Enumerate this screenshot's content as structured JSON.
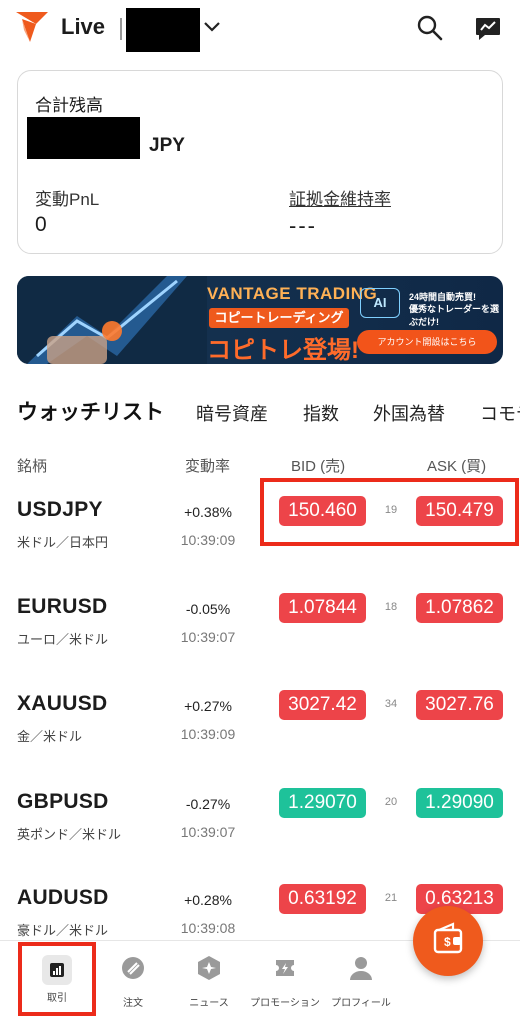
{
  "header": {
    "mode_label": "Live",
    "icons": [
      "search-icon",
      "chart-message-icon",
      "chevron-down-icon"
    ],
    "brand_color": "#ef5a1d"
  },
  "balance_card": {
    "total_label": "合計残高",
    "currency": "JPY",
    "pnl_label": "変動PnL",
    "pnl_value": "0",
    "margin_label": "証拠金維持率",
    "margin_value": "---"
  },
  "banner": {
    "title": "VANTAGE TRADING",
    "subtitle": "コピートレーディング",
    "headline": "コピトレ登場!",
    "ai_badge": "AI",
    "ai_text_1": "24時間自動売買!",
    "ai_text_2": "優秀なトレーダーを選ぶだけ!",
    "cta": "アカウント開設はこちら"
  },
  "tabs": [
    {
      "label": "ウォッチリスト"
    },
    {
      "label": "暗号資産"
    },
    {
      "label": "指数"
    },
    {
      "label": "外国為替"
    },
    {
      "label": "コモデ"
    }
  ],
  "columns": {
    "symbol": "銘柄",
    "change": "変動率",
    "bid": "BID (売)",
    "ask": "ASK (買)"
  },
  "rows": [
    {
      "symbol": "USDJPY",
      "desc": "米ドル／日本円",
      "change": "+0.38%",
      "time": "10:39:09",
      "bid": "150.460",
      "spread": "19",
      "ask": "150.479",
      "color": "red"
    },
    {
      "symbol": "EURUSD",
      "desc": "ユーロ／米ドル",
      "change": "-0.05%",
      "time": "10:39:07",
      "bid": "1.07844",
      "spread": "18",
      "ask": "1.07862",
      "color": "red"
    },
    {
      "symbol": "XAUUSD",
      "desc": "金／米ドル",
      "change": "+0.27%",
      "time": "10:39:09",
      "bid": "3027.42",
      "spread": "34",
      "ask": "3027.76",
      "color": "red"
    },
    {
      "symbol": "GBPUSD",
      "desc": "英ポンド／米ドル",
      "change": "-0.27%",
      "time": "10:39:07",
      "bid": "1.29070",
      "spread": "20",
      "ask": "1.29090",
      "color": "green"
    },
    {
      "symbol": "AUDUSD",
      "desc": "豪ドル／米ドル",
      "change": "+0.28%",
      "time": "10:39:08",
      "bid": "0.63192",
      "spread": "21",
      "ask": "0.63213",
      "color": "red"
    }
  ],
  "price_colors": {
    "red": "#ed4449",
    "green": "#1ec29a"
  },
  "bottom_nav": [
    {
      "label": "取引",
      "icon": "bar-chart-icon",
      "active": true
    },
    {
      "label": "注文",
      "icon": "order-icon",
      "active": false
    },
    {
      "label": "ニュース",
      "icon": "news-icon",
      "active": false
    },
    {
      "label": "プロモーション",
      "icon": "promotion-icon",
      "active": false
    },
    {
      "label": "プロフィール",
      "icon": "profile-icon",
      "active": false
    }
  ],
  "fab": {
    "icon": "wallet-dollar-icon"
  }
}
